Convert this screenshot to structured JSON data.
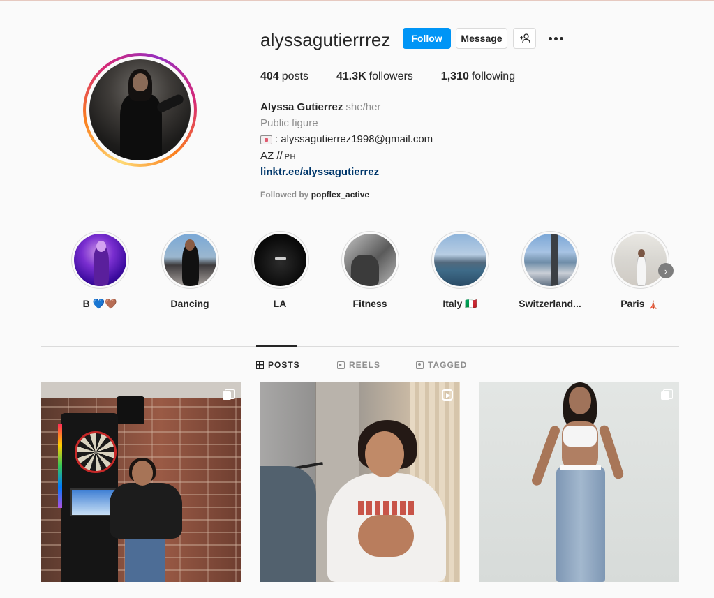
{
  "profile": {
    "username": "alyssagutierrrez",
    "follow_label": "Follow",
    "message_label": "Message",
    "add_user_icon": "add-user-icon",
    "more_icon": "more-options-icon",
    "stats": {
      "posts_count": "404",
      "posts_label": "posts",
      "followers_count": "41.3K",
      "followers_label": "followers",
      "following_count": "1,310",
      "following_label": "following"
    },
    "bio": {
      "full_name": "Alyssa Gutierrez",
      "pronouns": "she/her",
      "category": "Public figure",
      "email": " : alyssagutierrez1998@gmail.com",
      "location": "AZ //",
      "location_suffix": "PH",
      "link": "linktr.ee/alyssagutierrez"
    },
    "followed_by_prefix": "Followed by",
    "followed_by_user": "popflex_active"
  },
  "highlights": [
    {
      "label": "B 💙🤎"
    },
    {
      "label": "Dancing"
    },
    {
      "label": "LA"
    },
    {
      "label": "Fitness"
    },
    {
      "label": "Italy 🇮🇹"
    },
    {
      "label": "Switzerland..."
    },
    {
      "label": "Paris 🗼"
    }
  ],
  "tabs": [
    {
      "label": "POSTS",
      "active": true
    },
    {
      "label": "REELS",
      "active": false
    },
    {
      "label": "TAGGED",
      "active": false
    }
  ],
  "posts": [
    {
      "type": "multiple"
    },
    {
      "type": "reel"
    },
    {
      "type": "multiple"
    }
  ],
  "colors": {
    "follow_button": "#0095f6",
    "link": "#00376b",
    "muted_text": "#8e8e8e",
    "background": "#fafafa"
  }
}
